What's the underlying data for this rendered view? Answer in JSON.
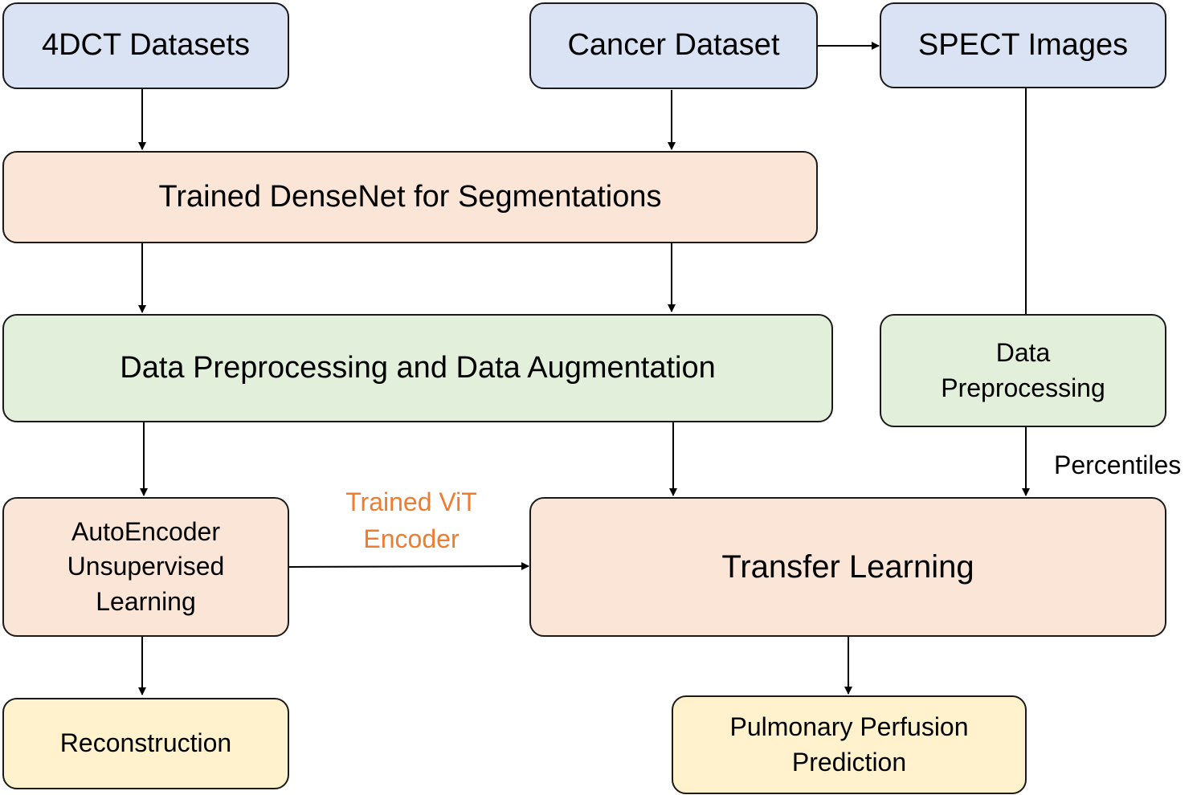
{
  "nodes": {
    "dct": "4DCT Datasets",
    "cancer": "Cancer Dataset",
    "spect": "SPECT Images",
    "densenet": "Trained DenseNet for Segmentations",
    "preproc_aug": "Data Preprocessing and Data Augmentation",
    "data_preproc_1": "Data",
    "data_preproc_2": "Preprocessing",
    "autoencoder_1": "AutoEncoder",
    "autoencoder_2": "Unsupervised",
    "autoencoder_3": "Learning",
    "transfer": "Transfer Learning",
    "reconstruction": "Reconstruction",
    "pulmonary_1": "Pulmonary Perfusion",
    "pulmonary_2": "Prediction"
  },
  "edge_labels": {
    "vit_1": "Trained ViT",
    "vit_2": "Encoder",
    "percentiles": "Percentiles"
  },
  "colors": {
    "blue": "#dae3f3",
    "peach": "#fbe5d6",
    "green": "#e2efda",
    "yellow": "#fff2cc",
    "accent_label": "#ed7d31"
  }
}
